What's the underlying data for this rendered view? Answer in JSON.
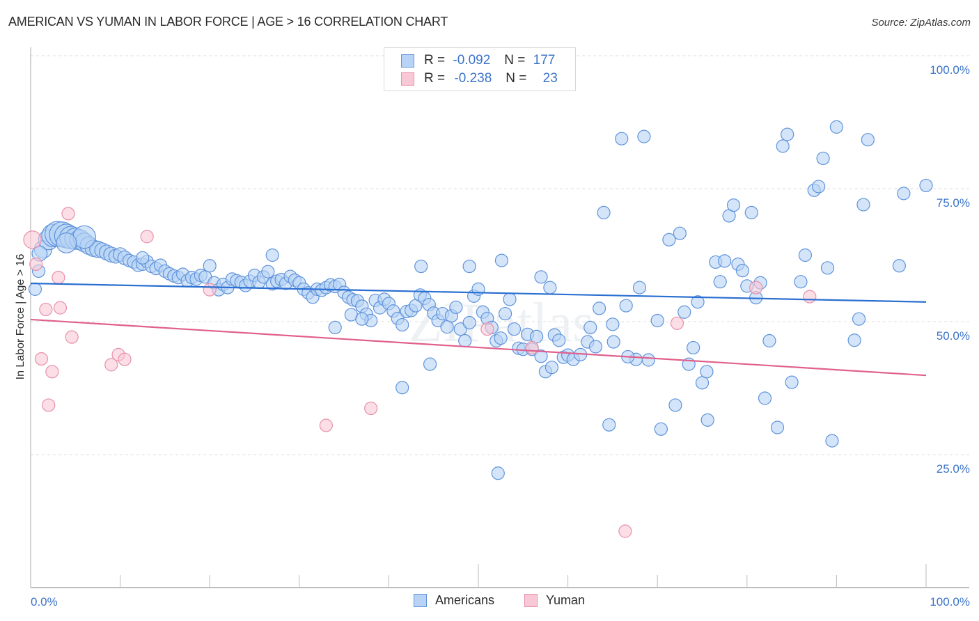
{
  "title": "AMERICAN VS YUMAN IN LABOR FORCE | AGE > 16 CORRELATION CHART",
  "source": "Source: ZipAtlas.com",
  "watermark": "ZIPatlas",
  "colors": {
    "americans_fill": "#b8d3f5",
    "americans_stroke": "#5f93db",
    "americans_line": "#2a6fd1",
    "yuman_fill": "#f9c8d6",
    "yuman_stroke": "#e890ab",
    "yuman_line": "#e0608c",
    "tick_text": "#3b74c9",
    "grid": "#dddddd"
  },
  "legend": {
    "rows": [
      {
        "series": "Americans",
        "r_label": "R =",
        "r_value": "-0.092",
        "n_label": "N =",
        "n_value": "177"
      },
      {
        "series": "Yuman",
        "r_label": "R =",
        "r_value": "-0.238",
        "n_label": "N =",
        "n_value": "23"
      }
    ]
  },
  "bottom_legend": [
    "Americans",
    "Yuman"
  ],
  "chart_data": {
    "type": "scatter",
    "title": "AMERICAN VS YUMAN IN LABOR FORCE | AGE > 16 CORRELATION CHART",
    "xlabel": "",
    "ylabel": "In Labor Force | Age > 16",
    "xlim": [
      0,
      100
    ],
    "ylim": [
      0,
      100
    ],
    "x_tick_labels": [
      "0.0%",
      "100.0%"
    ],
    "y_tick_labels": [
      {
        "value": 100,
        "label": "100.0%"
      },
      {
        "value": 75,
        "label": "75.0%"
      },
      {
        "value": 50,
        "label": "50.0%"
      },
      {
        "value": 25,
        "label": "25.0%"
      }
    ],
    "grid": "horizontal dashed at 25, 50, 75, 100",
    "legend_position": "top-center",
    "series": [
      {
        "name": "Americans",
        "r": -0.092,
        "n": 177,
        "trend": {
          "x": [
            0,
            100
          ],
          "y": [
            57.2,
            53.7
          ]
        },
        "points": [
          [
            0.5,
            56.1,
            1
          ],
          [
            0.9,
            59.5,
            1
          ],
          [
            1.4,
            63.6,
            1.4
          ],
          [
            2.0,
            65.4,
            1.6
          ],
          [
            2.5,
            66.2,
            1.8
          ],
          [
            3.0,
            66.5,
            2
          ],
          [
            3.5,
            66.4,
            2
          ],
          [
            4.0,
            66.1,
            1.9
          ],
          [
            4.5,
            65.8,
            1.8
          ],
          [
            5.0,
            65.6,
            1.7
          ],
          [
            5.5,
            65.4,
            1.6
          ],
          [
            6.0,
            64.9,
            1.5
          ],
          [
            6.5,
            64.3,
            1.4
          ],
          [
            7.0,
            63.8,
            1.3
          ],
          [
            7.5,
            63.6,
            1.3
          ],
          [
            8.0,
            63.4,
            1.2
          ],
          [
            8.5,
            63.0,
            1.2
          ],
          [
            9.0,
            62.6,
            1.2
          ],
          [
            9.5,
            62.3,
            1.1
          ],
          [
            10.0,
            62.6,
            1.1
          ],
          [
            10.5,
            62.0,
            1.1
          ],
          [
            11.0,
            61.5,
            1
          ],
          [
            11.5,
            61.2,
            1
          ],
          [
            12.0,
            60.6,
            1
          ],
          [
            12.5,
            60.8,
            1
          ],
          [
            13.0,
            61.3,
            1
          ],
          [
            13.5,
            60.4,
            1
          ],
          [
            14.0,
            60.0,
            1
          ],
          [
            14.5,
            60.6,
            1
          ],
          [
            15.0,
            59.5,
            1
          ],
          [
            15.5,
            59.0,
            1
          ],
          [
            16.0,
            58.6,
            1
          ],
          [
            16.5,
            58.3,
            1
          ],
          [
            17.0,
            58.9,
            1
          ],
          [
            17.5,
            57.7,
            1
          ],
          [
            18.0,
            58.3,
            1
          ],
          [
            18.5,
            58.0,
            1
          ],
          [
            19.0,
            58.7,
            1
          ],
          [
            19.5,
            58.4,
            1
          ],
          [
            20.0,
            60.5,
            1
          ],
          [
            20.5,
            57.3,
            1
          ],
          [
            21.0,
            56.0,
            1
          ],
          [
            21.5,
            57.0,
            1
          ],
          [
            22.0,
            56.4,
            1
          ],
          [
            22.5,
            58.0,
            1
          ],
          [
            23.0,
            57.7,
            1
          ],
          [
            23.5,
            57.4,
            1
          ],
          [
            24.0,
            56.8,
            1
          ],
          [
            24.5,
            57.6,
            1
          ],
          [
            25.0,
            58.7,
            1
          ],
          [
            25.5,
            57.4,
            1
          ],
          [
            26.0,
            58.4,
            1
          ],
          [
            26.5,
            59.4,
            1
          ],
          [
            27.0,
            57.1,
            1
          ],
          [
            27.5,
            57.6,
            1
          ],
          [
            28.0,
            57.9,
            1
          ],
          [
            28.5,
            57.2,
            1
          ],
          [
            29.0,
            58.5,
            1
          ],
          [
            29.5,
            57.8,
            1
          ],
          [
            30.0,
            57.3,
            1
          ],
          [
            30.5,
            56.1,
            1
          ],
          [
            31.0,
            55.4,
            1
          ],
          [
            31.5,
            54.6,
            1
          ],
          [
            32.0,
            56.1,
            1
          ],
          [
            32.5,
            55.9,
            1
          ],
          [
            33.0,
            56.4,
            1
          ],
          [
            33.5,
            56.9,
            1
          ],
          [
            34.0,
            56.6,
            1
          ],
          [
            34.5,
            57.0,
            1
          ],
          [
            35.0,
            55.5,
            1
          ],
          [
            35.5,
            54.6,
            1
          ],
          [
            36.0,
            54.1,
            1
          ],
          [
            36.5,
            53.9,
            1
          ],
          [
            37.0,
            52.9,
            1
          ],
          [
            37.5,
            51.4,
            1
          ],
          [
            38.0,
            50.2,
            1
          ],
          [
            38.5,
            54.0,
            1
          ],
          [
            39.0,
            52.6,
            1
          ],
          [
            39.5,
            54.2,
            1
          ],
          [
            40.0,
            53.4,
            1
          ],
          [
            40.5,
            52.0,
            1
          ],
          [
            41.0,
            50.6,
            1
          ],
          [
            41.5,
            49.4,
            1
          ],
          [
            42.0,
            51.9,
            1
          ],
          [
            42.5,
            52.1,
            1
          ],
          [
            43.0,
            53.0,
            1
          ],
          [
            43.5,
            55.0,
            1
          ],
          [
            44.0,
            54.4,
            1
          ],
          [
            44.5,
            53.2,
            1
          ],
          [
            45.0,
            51.6,
            1
          ],
          [
            45.5,
            50.2,
            1
          ],
          [
            46.0,
            51.5,
            1
          ],
          [
            46.5,
            49.0,
            1
          ],
          [
            47.0,
            51.1,
            1
          ],
          [
            47.5,
            52.7,
            1
          ],
          [
            48.0,
            48.6,
            1
          ],
          [
            48.5,
            46.4,
            1
          ],
          [
            49.0,
            49.8,
            1
          ],
          [
            49.5,
            54.8,
            1
          ],
          [
            50.0,
            56.1,
            1
          ],
          [
            50.5,
            51.8,
            1
          ],
          [
            51.0,
            50.6,
            1
          ],
          [
            51.5,
            48.9,
            1
          ],
          [
            52.0,
            46.4,
            1
          ],
          [
            52.5,
            46.9,
            1
          ],
          [
            53.0,
            51.5,
            1
          ],
          [
            53.5,
            54.2,
            1
          ],
          [
            54.0,
            48.6,
            1
          ],
          [
            54.5,
            45.0,
            1
          ],
          [
            55.0,
            44.8,
            1
          ],
          [
            55.5,
            47.6,
            1
          ],
          [
            56.0,
            44.8,
            1
          ],
          [
            56.5,
            47.2,
            1
          ],
          [
            57.0,
            43.5,
            1
          ],
          [
            57.5,
            40.6,
            1
          ],
          [
            58.0,
            56.4,
            1
          ],
          [
            58.5,
            47.5,
            1
          ],
          [
            59.0,
            46.5,
            1
          ],
          [
            59.5,
            43.3,
            1
          ],
          [
            60.0,
            43.7,
            1
          ],
          [
            6.0,
            65.9,
            1.8
          ],
          [
            4.0,
            64.8,
            1.6
          ],
          [
            1.0,
            62.8,
            1.2
          ],
          [
            12.5,
            62.0,
            1
          ],
          [
            27.0,
            62.5,
            1
          ],
          [
            43.6,
            60.4,
            1
          ],
          [
            52.6,
            61.5,
            1
          ],
          [
            49.0,
            60.4,
            1
          ],
          [
            57.0,
            58.4,
            1
          ],
          [
            44.6,
            42.0,
            1
          ],
          [
            41.5,
            37.6,
            1
          ],
          [
            52.2,
            21.5,
            1
          ],
          [
            35.8,
            51.3,
            1
          ],
          [
            34.0,
            48.9,
            1
          ],
          [
            37.0,
            50.5,
            1
          ],
          [
            62.5,
            48.9,
            1
          ],
          [
            63.5,
            52.5,
            1
          ],
          [
            65.0,
            49.5,
            1
          ],
          [
            66.5,
            53.0,
            1
          ],
          [
            68.0,
            56.4,
            1
          ],
          [
            66.0,
            84.4,
            1
          ],
          [
            68.5,
            84.8,
            1
          ],
          [
            64.0,
            70.5,
            1
          ],
          [
            69.0,
            42.8,
            1
          ],
          [
            70.0,
            50.2,
            1
          ],
          [
            71.3,
            65.4,
            1
          ],
          [
            72.5,
            66.6,
            1
          ],
          [
            73.0,
            51.8,
            1
          ],
          [
            73.5,
            42.0,
            1
          ],
          [
            74.0,
            45.1,
            1
          ],
          [
            74.5,
            53.7,
            1
          ],
          [
            72.0,
            34.3,
            1
          ],
          [
            75.0,
            38.5,
            1
          ],
          [
            75.5,
            40.6,
            1
          ],
          [
            76.5,
            61.2,
            1
          ],
          [
            77.0,
            57.5,
            1
          ],
          [
            78.0,
            69.9,
            1
          ],
          [
            77.5,
            61.4,
            1
          ],
          [
            78.5,
            71.9,
            1
          ],
          [
            79.0,
            60.8,
            1
          ],
          [
            79.5,
            59.6,
            1
          ],
          [
            80.5,
            70.5,
            1
          ],
          [
            80.0,
            56.7,
            1
          ],
          [
            81.0,
            54.5,
            1
          ],
          [
            81.5,
            57.3,
            1
          ],
          [
            82.5,
            46.4,
            1
          ],
          [
            82.0,
            35.6,
            1
          ],
          [
            84.0,
            83.0,
            1
          ],
          [
            84.5,
            85.2,
            1
          ],
          [
            85.0,
            38.6,
            1
          ],
          [
            86.0,
            57.5,
            1
          ],
          [
            86.5,
            62.5,
            1
          ],
          [
            87.5,
            74.7,
            1
          ],
          [
            88.0,
            75.4,
            1
          ],
          [
            88.5,
            80.7,
            1
          ],
          [
            89.0,
            60.1,
            1
          ],
          [
            89.5,
            27.6,
            1
          ],
          [
            90.0,
            86.6,
            1
          ],
          [
            92.0,
            46.5,
            1
          ],
          [
            92.5,
            50.5,
            1
          ],
          [
            93.0,
            72.0,
            1
          ],
          [
            93.5,
            84.2,
            1
          ],
          [
            97.0,
            60.5,
            1
          ],
          [
            97.5,
            74.1,
            1
          ],
          [
            100.0,
            75.6,
            1
          ],
          [
            83.4,
            30.1,
            1
          ],
          [
            75.6,
            31.5,
            1
          ],
          [
            64.6,
            30.6,
            1
          ],
          [
            70.4,
            29.8,
            1
          ],
          [
            58.2,
            41.4,
            1
          ],
          [
            60.6,
            42.9,
            1
          ],
          [
            61.4,
            43.8,
            1
          ],
          [
            67.6,
            42.9,
            1
          ],
          [
            62.2,
            46.2,
            1
          ],
          [
            63.1,
            45.3,
            1
          ],
          [
            65.1,
            46.2,
            1
          ],
          [
            66.7,
            43.4,
            1
          ]
        ]
      },
      {
        "name": "Yuman",
        "r": -0.238,
        "n": 23,
        "trend": {
          "x": [
            0,
            100
          ],
          "y": [
            50.4,
            39.9
          ]
        },
        "points": [
          [
            0.2,
            65.4,
            1.4
          ],
          [
            0.6,
            60.8,
            1
          ],
          [
            1.2,
            43.0,
            1
          ],
          [
            1.7,
            52.3,
            1
          ],
          [
            2.0,
            34.3,
            1
          ],
          [
            2.4,
            40.6,
            1
          ],
          [
            3.1,
            58.3,
            1
          ],
          [
            3.3,
            52.6,
            1
          ],
          [
            4.2,
            70.3,
            1
          ],
          [
            4.6,
            47.1,
            1
          ],
          [
            9.0,
            41.9,
            1
          ],
          [
            9.8,
            43.8,
            1
          ],
          [
            10.5,
            42.9,
            1
          ],
          [
            13.0,
            66.0,
            1
          ],
          [
            20.0,
            56.0,
            1
          ],
          [
            33.0,
            30.5,
            1
          ],
          [
            38.0,
            33.7,
            1
          ],
          [
            51.0,
            48.6,
            1
          ],
          [
            56.0,
            45.1,
            1
          ],
          [
            66.4,
            10.6,
            1
          ],
          [
            72.2,
            49.7,
            1
          ],
          [
            81.0,
            56.4,
            1
          ],
          [
            87.0,
            54.7,
            1
          ]
        ]
      }
    ]
  }
}
